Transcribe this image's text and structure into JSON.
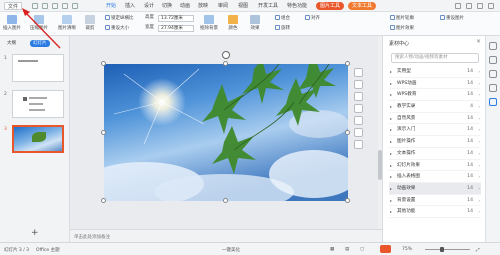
{
  "menubar": {
    "file": "文件",
    "items": [
      "开始",
      "插入",
      "设计",
      "切换",
      "动画",
      "放映",
      "审阅",
      "视图",
      "开发工具",
      "特色功能"
    ],
    "active_index": 0,
    "tool_tab_picture": "图片工具",
    "tool_tab_text": "文本工具"
  },
  "ribbon": {
    "insert_pic": "插入图片",
    "compress": "压缩图片",
    "clarity": "图片清晰",
    "crop": "裁剪",
    "keep_ratio": "锁定纵横比",
    "height_label": "高度",
    "height_value": "13.72厘米",
    "width_label": "宽度",
    "width_value": "27.94厘米",
    "reset_size": "重设大小",
    "cutout": "抠除背景",
    "color": "颜色",
    "effects": "效果",
    "combine": "组合",
    "rotate": "旋转",
    "align": "对齐",
    "pic_border": "图片轮廓",
    "pic_effect": "图片效果",
    "reset_pic": "重设图片"
  },
  "left_panel": {
    "tabs": [
      "大纲",
      "幻灯片"
    ],
    "active_tab": 1,
    "slides": [
      "1",
      "2",
      "3"
    ],
    "selected_slide": 2,
    "add_label": "+"
  },
  "notes_placeholder": "单击此处添加备注",
  "right_panel": {
    "title": "素材中心",
    "search_placeholder": "搜索人物/动画/视频等素材",
    "rows": [
      {
        "label": "实用型",
        "count": "14"
      },
      {
        "label": "WPS动画",
        "count": "14"
      },
      {
        "label": "WPS教育",
        "count": "14"
      },
      {
        "label": "教学实录",
        "count": "4"
      },
      {
        "label": "自然风景",
        "count": "14"
      },
      {
        "label": "演示入门",
        "count": "14"
      },
      {
        "label": "图片操作",
        "count": "14"
      },
      {
        "label": "文本操作",
        "count": "14"
      },
      {
        "label": "幻灯片效果",
        "count": "14"
      },
      {
        "label": "插入表格图",
        "count": "14"
      },
      {
        "label": "动画效果",
        "count": "14"
      },
      {
        "label": "背景设置",
        "count": "14"
      },
      {
        "label": "其他功能",
        "count": "14"
      }
    ],
    "selected_row": 10
  },
  "status": {
    "slide_info": "幻灯片 3 / 3",
    "theme": "Office 主题",
    "beautify": "一键美化",
    "zoom": "75%"
  },
  "colors": {
    "accent": "#2a7be4",
    "tool_tab": "#e8562a",
    "arrow": "#d9201f"
  }
}
